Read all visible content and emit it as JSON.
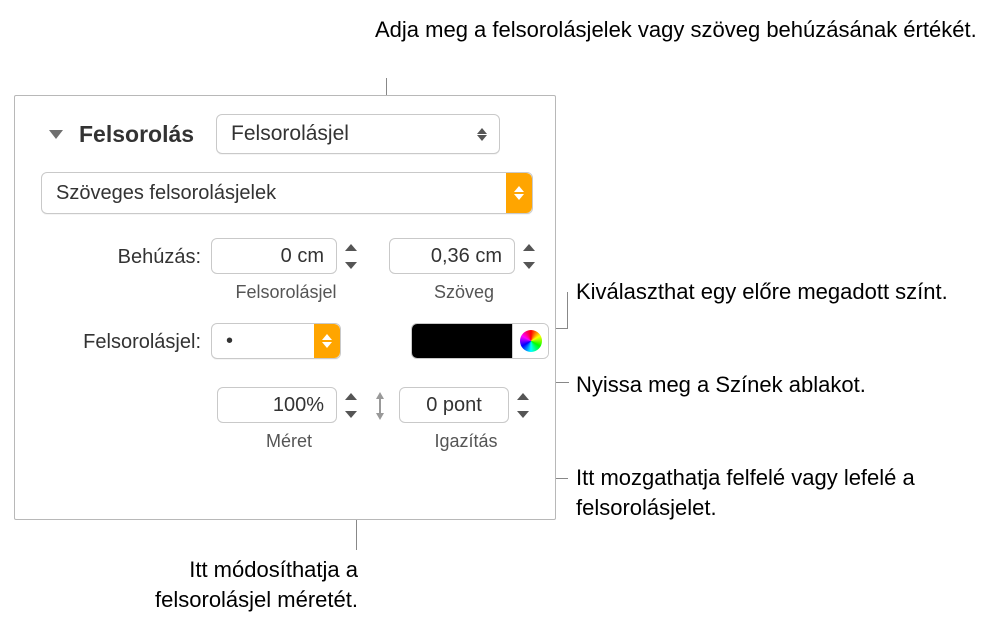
{
  "callouts": {
    "top": "Adja meg a felsorolásjelek vagy szöveg behúzásának értékét.",
    "right1": "Kiválaszthat egy előre megadott színt.",
    "right2": "Nyissa meg a Színek ablakot.",
    "right3": "Itt mozgathatja felfelé vagy lefelé a felsorolásjelet.",
    "bottom": "Itt módosíthatja a felsorolásjel méretét."
  },
  "panel": {
    "section_title": "Felsorolás",
    "style_popup": "Felsorolásjel",
    "type_popup": "Szöveges felsorolásjelek",
    "indent": {
      "label": "Behúzás:",
      "bullet_value": "0 cm",
      "bullet_sub": "Felsorolásjel",
      "text_value": "0,36 cm",
      "text_sub": "Szöveg"
    },
    "bullet_char": {
      "label": "Felsorolásjel:",
      "value": "•"
    },
    "size": {
      "value": "100%",
      "sub": "Méret"
    },
    "align": {
      "value": "0 pont",
      "sub": "Igazítás"
    }
  }
}
